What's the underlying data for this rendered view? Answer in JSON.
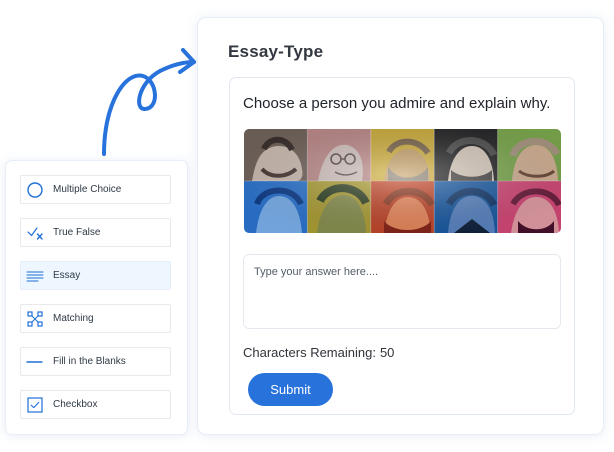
{
  "sidebar": {
    "items": [
      {
        "label": "Multiple Choice",
        "icon": "radio-circle-icon"
      },
      {
        "label": "True False",
        "icon": "check-x-icon"
      },
      {
        "label": "Essay",
        "icon": "lines-icon"
      },
      {
        "label": "Matching",
        "icon": "matching-icon"
      },
      {
        "label": "Fill in the Blanks",
        "icon": "dash-icon"
      },
      {
        "label": "Checkbox",
        "icon": "checkbox-icon"
      }
    ],
    "active_index": 2
  },
  "main": {
    "title": "Essay-Type",
    "question": "Choose a person you admire and explain why.",
    "portraits_image_name": "admired-people-portraits",
    "answer": {
      "value": "",
      "placeholder": "Type your answer here...."
    },
    "characters_label": "Characters Remaining:",
    "characters_remaining": 50,
    "submit_label": "Submit"
  },
  "colors": {
    "accent": "#2872dc",
    "active_background": "#eef6ff",
    "border": "#e5edf8",
    "text": "#333841"
  }
}
